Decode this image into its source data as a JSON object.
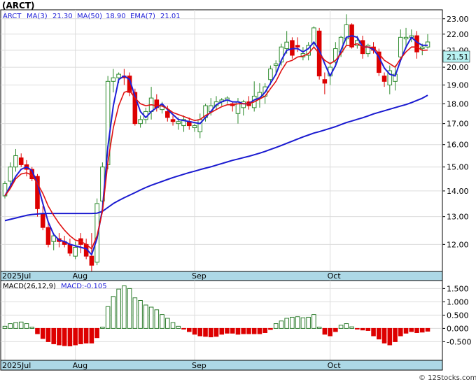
{
  "chart_data": [
    {
      "type": "candlestick",
      "title": "(ARCT)",
      "legend": {
        "ticker": "ARCT",
        "ma_short_label": "MA(3)",
        "ma_short_value": "21.30",
        "ma_long_label": "MA(50)",
        "ma_long_value": "18.90",
        "ema_label": "EMA(7)",
        "ema_value": "21.01"
      },
      "last_price": "21.51",
      "y_ticks": [
        "12.00",
        "13.00",
        "14.00",
        "15.00",
        "16.00",
        "17.00",
        "18.00",
        "19.00",
        "20.00",
        "21.00",
        "22.00",
        "23.00"
      ],
      "ylim": [
        11.1,
        23.6
      ],
      "y_scale": "log",
      "x_labels": [
        {
          "label": "2025Jul",
          "index": 0
        },
        {
          "label": "Aug",
          "index": 13
        },
        {
          "label": "Sep",
          "index": 35
        },
        {
          "label": "Oct",
          "index": 60
        }
      ],
      "ohlc": [
        [
          13.8,
          14.4,
          13.7,
          14.3
        ],
        [
          14.4,
          15.2,
          14.1,
          15.0
        ],
        [
          15.0,
          15.8,
          14.8,
          15.5
        ],
        [
          15.4,
          15.6,
          15.0,
          15.1
        ],
        [
          15.1,
          15.3,
          14.6,
          14.9
        ],
        [
          14.9,
          15.0,
          14.4,
          14.5
        ],
        [
          14.6,
          14.7,
          13.0,
          13.3
        ],
        [
          13.1,
          13.4,
          12.5,
          12.6
        ],
        [
          12.6,
          12.8,
          11.9,
          12.0
        ],
        [
          12.1,
          12.4,
          11.8,
          12.3
        ],
        [
          12.2,
          12.4,
          11.9,
          12.1
        ],
        [
          12.1,
          12.3,
          11.9,
          12.0
        ],
        [
          12.0,
          12.2,
          11.6,
          11.7
        ],
        [
          11.6,
          12.1,
          11.5,
          11.9
        ],
        [
          12.2,
          12.4,
          11.7,
          12.0
        ],
        [
          12.0,
          12.2,
          11.5,
          11.6
        ],
        [
          11.6,
          12.4,
          11.1,
          11.3
        ],
        [
          11.4,
          13.7,
          11.3,
          13.5
        ],
        [
          13.6,
          15.2,
          13.4,
          15.0
        ],
        [
          15.1,
          19.5,
          14.9,
          19.2
        ],
        [
          19.2,
          19.9,
          18.6,
          19.4
        ],
        [
          19.4,
          19.7,
          19.1,
          19.6
        ],
        [
          19.5,
          19.9,
          19.0,
          19.4
        ],
        [
          19.5,
          19.7,
          18.4,
          18.6
        ],
        [
          18.6,
          18.8,
          16.9,
          17.0
        ],
        [
          17.0,
          17.4,
          16.8,
          17.2
        ],
        [
          17.2,
          17.8,
          17.0,
          17.6
        ],
        [
          17.6,
          18.9,
          17.2,
          18.3
        ],
        [
          18.2,
          18.5,
          17.6,
          17.8
        ],
        [
          17.7,
          18.1,
          17.5,
          17.9
        ],
        [
          17.6,
          17.9,
          17.1,
          17.3
        ],
        [
          17.2,
          17.4,
          16.9,
          17.1
        ],
        [
          17.0,
          17.3,
          16.7,
          17.1
        ],
        [
          16.9,
          17.4,
          16.6,
          17.2
        ],
        [
          17.1,
          17.3,
          16.7,
          16.9
        ],
        [
          16.8,
          17.0,
          16.6,
          16.9
        ],
        [
          16.6,
          17.5,
          16.3,
          17.2
        ],
        [
          17.3,
          18.0,
          17.1,
          17.9
        ],
        [
          17.6,
          18.3,
          17.4,
          17.9
        ],
        [
          17.9,
          18.4,
          17.7,
          18.1
        ],
        [
          18.1,
          18.3,
          17.9,
          18.2
        ],
        [
          18.2,
          18.4,
          18.0,
          18.3
        ],
        [
          18.0,
          18.1,
          17.6,
          17.9
        ],
        [
          17.5,
          18.3,
          17.0,
          18.1
        ],
        [
          17.8,
          18.2,
          17.4,
          18.1
        ],
        [
          18.1,
          18.4,
          17.7,
          17.9
        ],
        [
          17.8,
          19.2,
          17.6,
          18.4
        ],
        [
          18.3,
          19.1,
          17.8,
          18.6
        ],
        [
          18.4,
          19.1,
          18.0,
          18.9
        ],
        [
          19.3,
          20.1,
          19.0,
          19.9
        ],
        [
          20.1,
          20.4,
          19.6,
          20.2
        ],
        [
          20.3,
          21.4,
          20.1,
          21.2
        ],
        [
          21.1,
          22.2,
          20.8,
          21.5
        ],
        [
          21.6,
          21.8,
          20.5,
          20.7
        ],
        [
          21.3,
          21.8,
          20.9,
          21.2
        ],
        [
          20.6,
          21.2,
          20.4,
          20.8
        ],
        [
          20.7,
          21.5,
          20.4,
          21.3
        ],
        [
          21.4,
          22.5,
          21.2,
          22.4
        ],
        [
          22.2,
          22.4,
          19.3,
          19.5
        ],
        [
          19.3,
          19.7,
          18.5,
          19.1
        ],
        [
          19.5,
          20.3,
          19.0,
          20.0
        ],
        [
          20.3,
          21.5,
          20.0,
          21.1
        ],
        [
          20.9,
          21.9,
          20.6,
          21.8
        ],
        [
          21.7,
          23.3,
          21.3,
          22.6
        ],
        [
          22.6,
          22.7,
          21.1,
          21.2
        ],
        [
          21.3,
          21.9,
          21.1,
          21.6
        ],
        [
          21.6,
          21.9,
          20.5,
          20.8
        ],
        [
          20.8,
          21.4,
          20.6,
          21.3
        ],
        [
          21.2,
          21.5,
          20.8,
          21.0
        ],
        [
          20.9,
          21.1,
          19.5,
          19.7
        ],
        [
          19.5,
          19.7,
          18.9,
          19.2
        ],
        [
          19.0,
          20.1,
          18.5,
          19.8
        ],
        [
          19.2,
          20.1,
          18.7,
          19.6
        ],
        [
          20.6,
          22.3,
          20.3,
          21.8
        ],
        [
          21.7,
          22.4,
          21.1,
          21.8
        ],
        [
          21.8,
          22.3,
          21.5,
          21.9
        ],
        [
          21.9,
          22.2,
          20.5,
          20.9
        ],
        [
          21.1,
          21.4,
          20.7,
          21.2
        ],
        [
          21.2,
          22.0,
          21.1,
          21.51
        ]
      ],
      "ma50": [
        12.85,
        12.9,
        12.95,
        13.0,
        13.05,
        13.08,
        13.1,
        13.12,
        13.12,
        13.12,
        13.12,
        13.12,
        13.12,
        13.12,
        13.12,
        13.12,
        13.12,
        13.13,
        13.2,
        13.35,
        13.5,
        13.62,
        13.73,
        13.83,
        13.93,
        14.04,
        14.14,
        14.23,
        14.31,
        14.39,
        14.47,
        14.55,
        14.62,
        14.69,
        14.76,
        14.82,
        14.89,
        14.95,
        15.01,
        15.08,
        15.15,
        15.22,
        15.29,
        15.35,
        15.41,
        15.47,
        15.54,
        15.61,
        15.69,
        15.78,
        15.87,
        15.96,
        16.06,
        16.16,
        16.26,
        16.36,
        16.45,
        16.54,
        16.61,
        16.69,
        16.77,
        16.85,
        16.95,
        17.05,
        17.13,
        17.21,
        17.29,
        17.38,
        17.48,
        17.56,
        17.64,
        17.72,
        17.8,
        17.88,
        17.96,
        18.06,
        18.17,
        18.29,
        18.45
      ],
      "ema7": [
        13.8,
        14.1,
        14.5,
        14.7,
        14.75,
        14.65,
        14.3,
        13.9,
        13.4,
        13.05,
        12.75,
        12.5,
        12.3,
        12.15,
        12.1,
        12.0,
        11.85,
        12.3,
        13.2,
        15.2,
        16.8,
        17.9,
        18.6,
        18.7,
        18.3,
        18.0,
        17.9,
        17.95,
        17.9,
        17.88,
        17.75,
        17.55,
        17.45,
        17.35,
        17.25,
        17.15,
        17.2,
        17.4,
        17.55,
        17.7,
        17.85,
        17.95,
        17.95,
        18.0,
        18.0,
        18.0,
        18.1,
        18.25,
        18.4,
        18.8,
        19.2,
        19.8,
        20.3,
        20.4,
        20.6,
        20.65,
        20.8,
        21.2,
        20.8,
        20.4,
        20.2,
        20.4,
        20.8,
        21.3,
        21.3,
        21.4,
        21.2,
        21.2,
        21.15,
        20.8,
        20.4,
        20.2,
        20.0,
        20.5,
        20.9,
        21.2,
        21.2,
        21.0,
        21.01
      ],
      "ma3": [
        13.8,
        14.2,
        14.6,
        14.9,
        15.0,
        14.85,
        14.3,
        13.5,
        12.8,
        12.35,
        12.15,
        12.1,
        12.0,
        11.95,
        11.9,
        11.85,
        11.65,
        12.2,
        13.3,
        15.9,
        17.9,
        19.3,
        19.5,
        19.3,
        18.4,
        17.6,
        17.3,
        17.6,
        17.8,
        18.0,
        17.7,
        17.45,
        17.2,
        17.15,
        17.1,
        17.05,
        17.0,
        17.3,
        17.6,
        17.95,
        18.1,
        18.2,
        18.1,
        18.1,
        18.0,
        18.0,
        18.2,
        18.3,
        18.6,
        19.1,
        19.6,
        20.4,
        21.0,
        21.1,
        21.1,
        20.9,
        21.1,
        21.5,
        21.0,
        20.2,
        19.5,
        20.1,
        21.0,
        21.8,
        21.9,
        21.8,
        21.2,
        21.2,
        21.05,
        20.6,
        19.95,
        19.6,
        19.5,
        20.4,
        21.2,
        21.8,
        21.5,
        21.3,
        21.3
      ]
    },
    {
      "type": "bar",
      "title": "MACD(26,12,9)",
      "value_label": "MACD:-0.105",
      "y_ticks": [
        "-0.500",
        "0.000",
        "0.500",
        "1.000",
        "1.500"
      ],
      "ylim": [
        -1.2,
        1.8
      ],
      "x_labels": [
        {
          "label": "2025Jul",
          "index": 0
        },
        {
          "label": "Aug",
          "index": 13
        },
        {
          "label": "Sep",
          "index": 35
        },
        {
          "label": "Oct",
          "index": 60
        }
      ],
      "values": [
        0.08,
        0.18,
        0.22,
        0.24,
        0.18,
        0.05,
        -0.2,
        -0.38,
        -0.5,
        -0.58,
        -0.62,
        -0.65,
        -0.66,
        -0.62,
        -0.58,
        -0.55,
        -0.55,
        -0.35,
        0.05,
        0.82,
        1.2,
        1.48,
        1.6,
        1.5,
        1.15,
        1.05,
        0.88,
        0.8,
        0.7,
        0.52,
        0.38,
        0.22,
        0.08,
        -0.02,
        -0.12,
        -0.22,
        -0.28,
        -0.3,
        -0.32,
        -0.3,
        -0.22,
        -0.18,
        -0.18,
        -0.22,
        -0.2,
        -0.2,
        -0.2,
        -0.2,
        -0.16,
        -0.04,
        0.18,
        0.28,
        0.38,
        0.42,
        0.44,
        0.4,
        0.42,
        0.52,
        0.05,
        -0.22,
        -0.28,
        -0.12,
        0.12,
        0.18,
        0.06,
        -0.02,
        -0.06,
        -0.08,
        -0.28,
        -0.4,
        -0.55,
        -0.62,
        -0.5,
        -0.28,
        -0.18,
        -0.12,
        -0.16,
        -0.14,
        -0.105
      ]
    }
  ],
  "watermark": "© 12Stocks.com",
  "colors": {
    "background": "#ffffff",
    "panel_border": "#000000",
    "axis_bar": "#add8e6",
    "grid": "#dcdcdc",
    "bull_body": "#ffffff",
    "bull_edge": "#2e8b2e",
    "bear_body": "#dd0000",
    "ma_short": "#1f1fd8",
    "ma_long": "#1a1ad0",
    "ema": "#e01010",
    "price_box": "#b8f2f2",
    "macd_pos_edge": "#2e7d2e",
    "macd_neg": "#dd0000",
    "legend_text": "#1f1fd8"
  }
}
